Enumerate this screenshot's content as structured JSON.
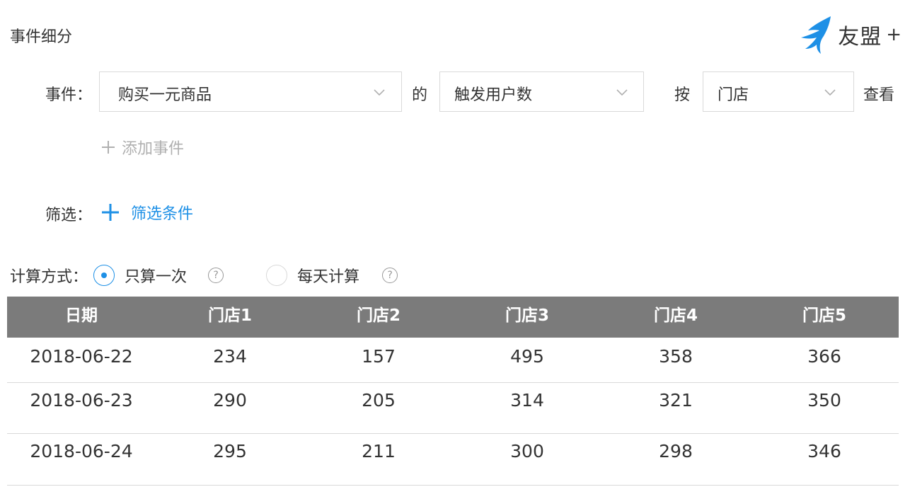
{
  "page": {
    "title": "事件细分"
  },
  "brand": {
    "name": "友盟",
    "plus": "+",
    "accent": "#1e90e6"
  },
  "event_row": {
    "label": "事件：",
    "event_select": "购买一元商品",
    "connector": "的",
    "metric_select": "触发用户数",
    "by_label": "按",
    "group_select": "门店",
    "view_label": "查看"
  },
  "add_event": {
    "label": "添加事件"
  },
  "filter": {
    "label": "筛选：",
    "add_label": "筛选条件"
  },
  "calc": {
    "label": "计算方式：",
    "options": [
      {
        "label": "只算一次",
        "selected": true
      },
      {
        "label": "每天计算",
        "selected": false
      }
    ],
    "help": "?"
  },
  "table": {
    "headers": [
      "日期",
      "门店1",
      "门店2",
      "门店3",
      "门店4",
      "门店5"
    ],
    "rows": [
      [
        "2018-06-22",
        "234",
        "157",
        "495",
        "358",
        "366"
      ],
      [
        "2018-06-23",
        "290",
        "205",
        "314",
        "321",
        "350"
      ],
      [
        "2018-06-24",
        "295",
        "211",
        "300",
        "298",
        "346"
      ]
    ]
  }
}
